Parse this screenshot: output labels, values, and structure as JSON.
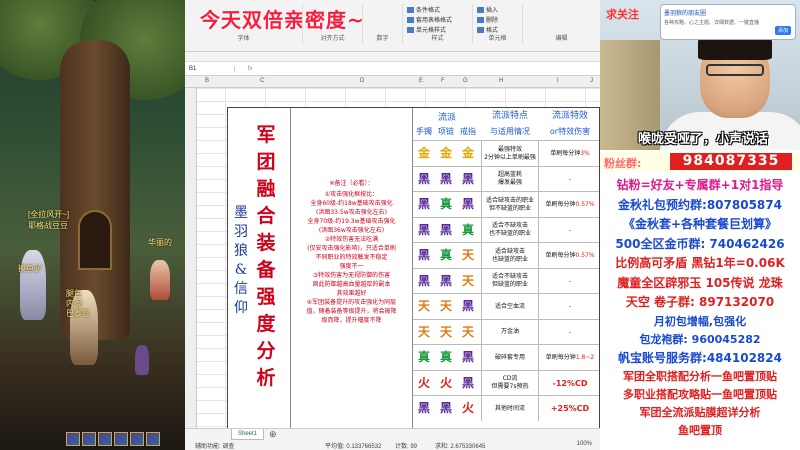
{
  "game": {
    "labels": {
      "guild": "[全拉风开~]",
      "player": "耶格战豆豆",
      "npc1": "华丽的",
      "npc2": "摸鱼驴",
      "npc3": "腿鱼",
      "npc4": "内阁",
      "npc5": "巴泰鲁"
    }
  },
  "excel": {
    "banner": "今天双倍亲密度~",
    "ribbon": {
      "font": "字体",
      "align": "对齐方式",
      "number": "数字",
      "style": "样式",
      "cells": "单元格",
      "edit": "编辑",
      "cond_format": "条件格式",
      "table_format": "套用表格格式",
      "cell_style": "单元格样式",
      "insert": "插入",
      "delete": "删除",
      "format": "格式"
    },
    "namebox": "B1",
    "fx": "fx",
    "columns": [
      "B",
      "C",
      "D",
      "E",
      "F",
      "G",
      "H",
      "I",
      "J"
    ],
    "title": "军团融合装备强度分析",
    "authors": "墨羽狼&信仰",
    "notes_title": "※备注（必看）：",
    "notes": [
      "①攻击强化框按比：",
      "全身60级-约18w基础攻击强化",
      "(洪图33.5w攻击强化左右)",
      "全身70级-约19.3w基础攻击强化",
      "(洪图36w攻击强化左右)",
      "②特效伤害无法吃满",
      "(仅安攻击强化影响)，只适合单刷",
      "不同职业的特效触发不稳定",
      "强度不一",
      "③特效伤害为无视防御的伤害",
      "固此防御越高血量越厚的副本",
      "其效果越好",
      "④军团装备提升的攻击强化为同层",
      "值，随着装备等级提升，将会被降",
      "级而降，提升幅度不降"
    ],
    "header": {
      "school": "流派",
      "features": "流派特点",
      "features2": "与适用情况",
      "effect": "流派特效",
      "effect2": "or特效伤害",
      "bracelet": "手镯",
      "necklace": "项链",
      "ring": "戒指"
    },
    "rows": [
      {
        "g": [
          "金",
          "金",
          "金"
        ],
        "c": [
          "#e6a800",
          "#e6a800",
          "#e6a800"
        ],
        "feat": "最强特效\n2分钟以上单刷最强",
        "eff": "单刷每分钟",
        "hi": "3%"
      },
      {
        "g": [
          "黑",
          "黑",
          "黑"
        ],
        "c": [
          "#5a2a9a",
          "#5a2a9a",
          "#5a2a9a"
        ],
        "feat": "超高蓝耗\n爆发最强",
        "eff": "-",
        "hi": ""
      },
      {
        "g": [
          "黑",
          "真",
          "黑"
        ],
        "c": [
          "#5a2a9a",
          "#1a9a3a",
          "#5a2a9a"
        ],
        "feat": "适合缺攻击的职业\n但不缺蓝的职业",
        "eff": "单刷每分钟",
        "hi": "0.57%"
      },
      {
        "g": [
          "黑",
          "黑",
          "真"
        ],
        "c": [
          "#5a2a9a",
          "#5a2a9a",
          "#1a9a3a"
        ],
        "feat": "适合不缺攻击\n也不缺蓝的职业",
        "eff": "-",
        "hi": ""
      },
      {
        "g": [
          "黑",
          "真",
          "天"
        ],
        "c": [
          "#5a2a9a",
          "#1a9a3a",
          "#e07a10"
        ],
        "feat": "适合缺攻击\n也缺蓝的职业",
        "eff": "单刷每分钟",
        "hi": "0.57%"
      },
      {
        "g": [
          "黑",
          "黑",
          "天"
        ],
        "c": [
          "#5a2a9a",
          "#5a2a9a",
          "#e07a10"
        ],
        "feat": "适合不缺攻击\n但缺蓝的职业",
        "eff": "-",
        "hi": ""
      },
      {
        "g": [
          "天",
          "天",
          "黑"
        ],
        "c": [
          "#e07a10",
          "#e07a10",
          "#5a2a9a"
        ],
        "feat": "适合空血流",
        "eff": "-",
        "hi": ""
      },
      {
        "g": [
          "天",
          "天",
          "天"
        ],
        "c": [
          "#e07a10",
          "#e07a10",
          "#e07a10"
        ],
        "feat": "万金油",
        "eff": "-",
        "hi": ""
      },
      {
        "g": [
          "真",
          "真",
          "黑"
        ],
        "c": [
          "#1a9a3a",
          "#1a9a3a",
          "#5a2a9a"
        ],
        "feat": "破碎套专用",
        "eff": "单刷每分钟",
        "hi": "1.8~2"
      },
      {
        "g": [
          "火",
          "火",
          "黑"
        ],
        "c": [
          "#e0201a",
          "#e0201a",
          "#5a2a9a"
        ],
        "feat": "CD流\n但需要7s预热",
        "eff": "",
        "hi": "-12%CD"
      },
      {
        "g": [
          "黑",
          "黑",
          "火"
        ],
        "c": [
          "#5a2a9a",
          "#5a2a9a",
          "#e0201a"
        ],
        "feat": "其他时间流",
        "eff": "",
        "hi": "+25%CD"
      }
    ],
    "status": {
      "tab": "Sheet1",
      "add": "⊕",
      "mode": "辅助功能: 调查",
      "avg": "平均值: 0.133766532",
      "count": "计数: 99",
      "sum": "求和: 2.675330645",
      "zoom": "100%"
    }
  },
  "stream": {
    "follow": "求关注",
    "wechat_title": "墨羽狼的朋友圈",
    "wechat_sub": "各种攻略、心之主题、详细数据、一键直播",
    "wechat_btn": "添加",
    "caption": "喉咙受哑了，小声说话",
    "fan_label": "粉丝群:",
    "fan_number": "984087335",
    "lines": [
      {
        "text": "钻粉=好友+专属群+1对1指导",
        "color": "#e01a8a",
        "size": 12
      },
      {
        "text": "金秋礼包预约群:807805874",
        "color": "#1a4ad0",
        "size": 12
      },
      {
        "text": "《金秋套+各种套餐巨划算》",
        "color": "#1a4ad0",
        "size": 12
      },
      {
        "text": "500全区金币群: 740462426",
        "color": "#1a4ad0",
        "size": 12
      },
      {
        "text": "比例高可矛盾 黑钻1年=0.06K",
        "color": "#e02020",
        "size": 12
      },
      {
        "text": "魔童全区辟邪玉 105传说 龙珠",
        "color": "#e02020",
        "size": 12
      },
      {
        "text": "天空 卷子群: 897132070",
        "color": "#e02020",
        "size": 12
      },
      {
        "text": "月初包增幅,包强化",
        "color": "#1a4ad0",
        "size": 11
      },
      {
        "text": "包龙袍群: 960045282",
        "color": "#1a4ad0",
        "size": 11
      },
      {
        "text": "帆宝账号服务群:484102824",
        "color": "#1a4ad0",
        "size": 12
      },
      {
        "text": "军团全职搭配分析一鱼吧置顶贴",
        "color": "#e02020",
        "size": 11
      },
      {
        "text": "多职业搭配攻略贴一鱼吧置顶贴",
        "color": "#e02020",
        "size": 11
      },
      {
        "text": "军团全流派贴膜超详分析",
        "color": "#e02020",
        "size": 11
      },
      {
        "text": "鱼吧置顶",
        "color": "#e02020",
        "size": 11
      }
    ]
  }
}
